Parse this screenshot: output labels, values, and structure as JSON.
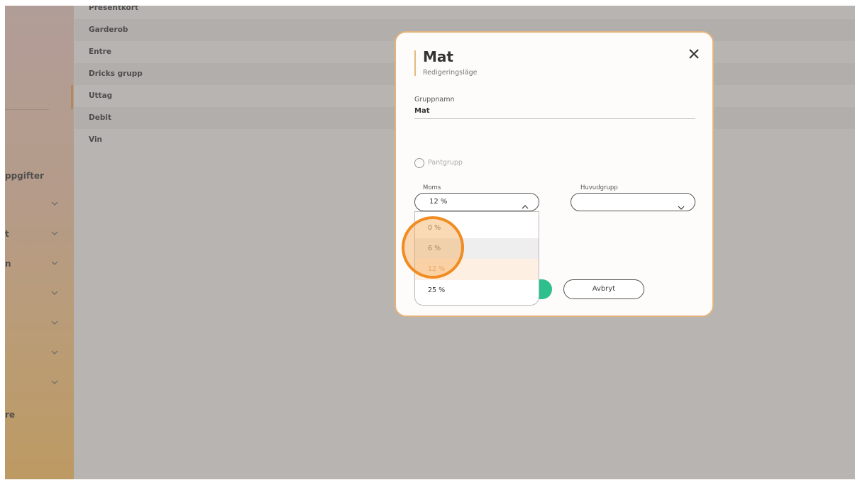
{
  "sidebar": {
    "labels": [
      {
        "text": "ppgifter",
        "name": "sidebar-label-uppgifter"
      },
      {
        "text": "t",
        "name": "sidebar-label-t"
      },
      {
        "text": "n",
        "name": "sidebar-label-n"
      },
      {
        "text": "re",
        "name": "sidebar-label-re"
      }
    ]
  },
  "groups": {
    "rows": [
      "Presentkort",
      "Garderob",
      "Entre",
      "Dricks grupp",
      "Uttag",
      "Debit",
      "Vin"
    ]
  },
  "modal": {
    "title": "Mat",
    "subtitle": "Redigeringsläge",
    "close_icon": "close-icon",
    "group_name_label": "Gruppnamn",
    "group_name_value": "Mat",
    "pant_label": "Pantgrupp",
    "moms_label": "Moms",
    "moms_value": "12 %",
    "huvudgrupp_label": "Huvudgrupp",
    "huvudgrupp_value": "",
    "cancel_label": "Avbryt",
    "moms_options": [
      "0 %",
      "6 %",
      "12 %",
      "25 %"
    ]
  },
  "colors": {
    "accent": "#e3b37c",
    "save": "#2dbf8d",
    "highlight": "#f08c22"
  }
}
